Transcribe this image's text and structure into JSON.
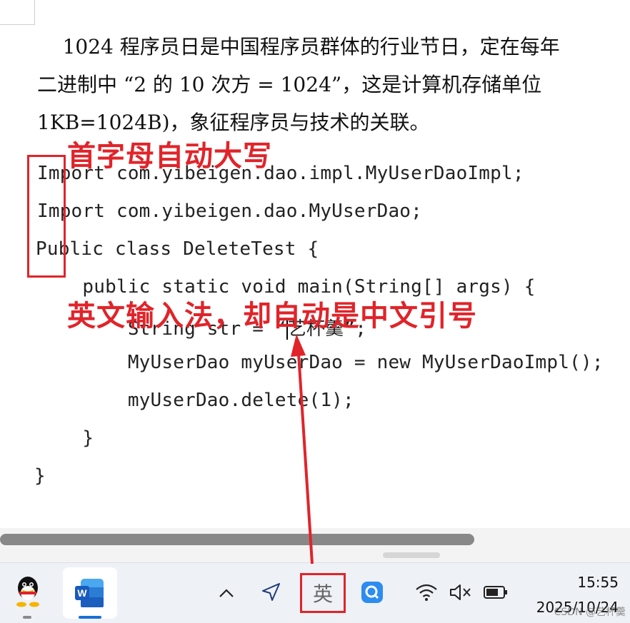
{
  "document": {
    "para_line1": "    1024 程序员日是中国程序员群体的行业节日，定在每年",
    "para_line2": "二进制中 “2 的 10 次方 = 1024”，这是计算机存储单位",
    "para_line3": "1KB=1024B)，象征程序员与技术的关联。",
    "code": [
      "Import com.yibeigen.dao.impl.MyUserDaoImpl;",
      "Import com.yibeigen.dao.MyUserDao;",
      "Public class DeleteTest {",
      "    public static void main(String[] args) {",
      "        String str = ",
      "        MyUserDao myUserDao = new MyUserDaoImpl();",
      "        myUserDao.delete(1);",
      "    }",
      "}"
    ],
    "str_open_quote": "“",
    "str_value": "艺杯羹",
    "str_close": "”;"
  },
  "annotations": {
    "capitalize_label": "首字母自动大写",
    "quote_label": "英文输入法，却自动是中文引号",
    "color": "#e0242a"
  },
  "taskbar": {
    "ime_label": "英",
    "time": "15:55",
    "date": "2025/10/24",
    "watermark": "CSDN @艺杯羹",
    "icons": [
      "qq-icon",
      "word-icon",
      "chevron-up-icon",
      "location-arrow-icon",
      "ime-icon",
      "q-app-icon",
      "wifi-icon",
      "speaker-muted-icon",
      "battery-icon"
    ]
  }
}
